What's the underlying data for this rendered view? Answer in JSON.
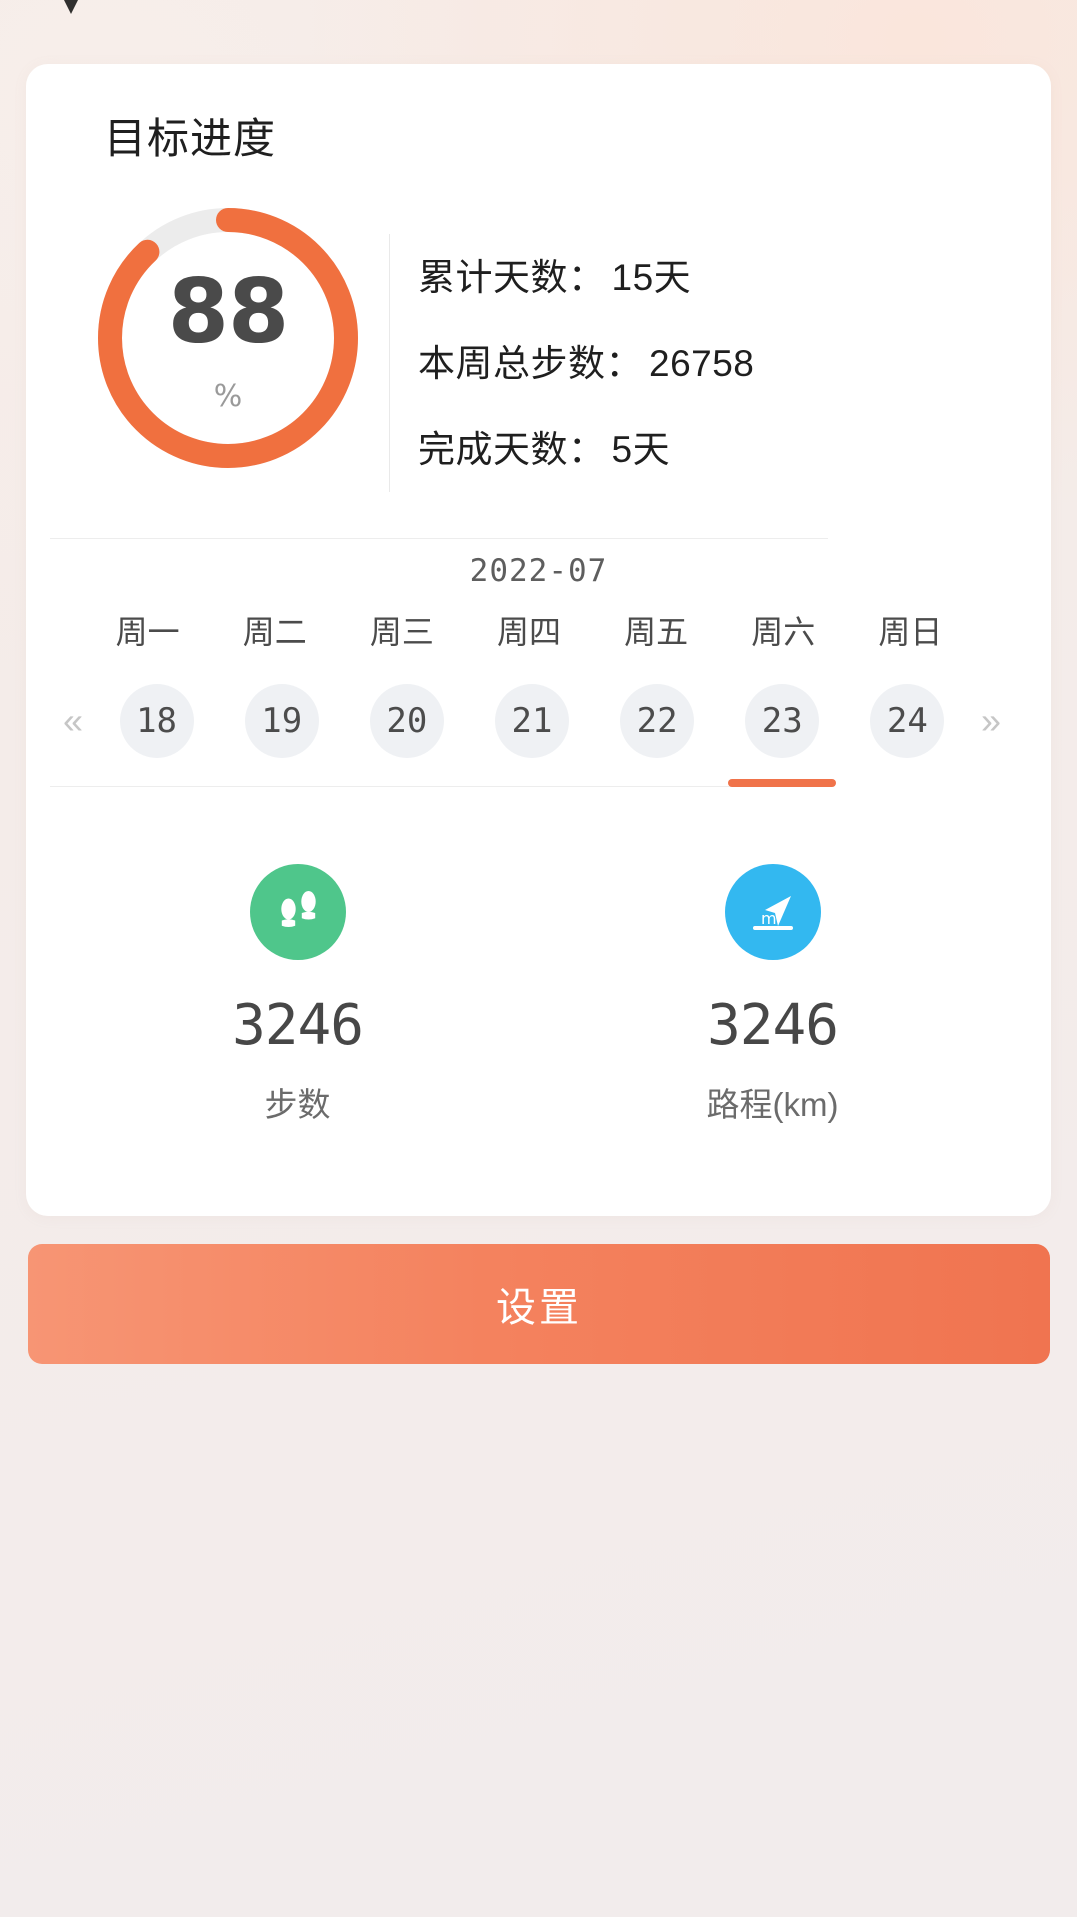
{
  "card": {
    "title": "目标进度",
    "progress": {
      "value": "88",
      "unit": "%",
      "percent": 88,
      "ring_color": "#f0703f",
      "track_color": "#ececec"
    },
    "stats": [
      {
        "label": "累计天数：",
        "value": "15天"
      },
      {
        "label": "本周总步数：",
        "value": "26758"
      },
      {
        "label": "完成天数：",
        "value": "5天"
      }
    ],
    "calendar": {
      "month": "2022-07",
      "prev_icon": "chevron-double-left-icon",
      "next_icon": "chevron-double-right-icon",
      "prev_glyph": "«",
      "next_glyph": "»",
      "weekdays": [
        "周一",
        "周二",
        "周三",
        "周四",
        "周五",
        "周六",
        "周日"
      ],
      "days": [
        "18",
        "19",
        "20",
        "21",
        "22",
        "23",
        "24"
      ],
      "selected_index": 5,
      "indicator_color": "#f0734a"
    },
    "metrics": [
      {
        "icon": "footprints-icon",
        "icon_color": "#4fc68b",
        "value": "3246",
        "label": "步数"
      },
      {
        "icon": "navigation-arrow-icon",
        "icon_color": "#33b8f0",
        "icon_text": "m",
        "value": "3246",
        "label": "路程(km)"
      }
    ]
  },
  "settings_button": {
    "label": "设置",
    "color_start": "#f79574",
    "color_end": "#f07450"
  }
}
